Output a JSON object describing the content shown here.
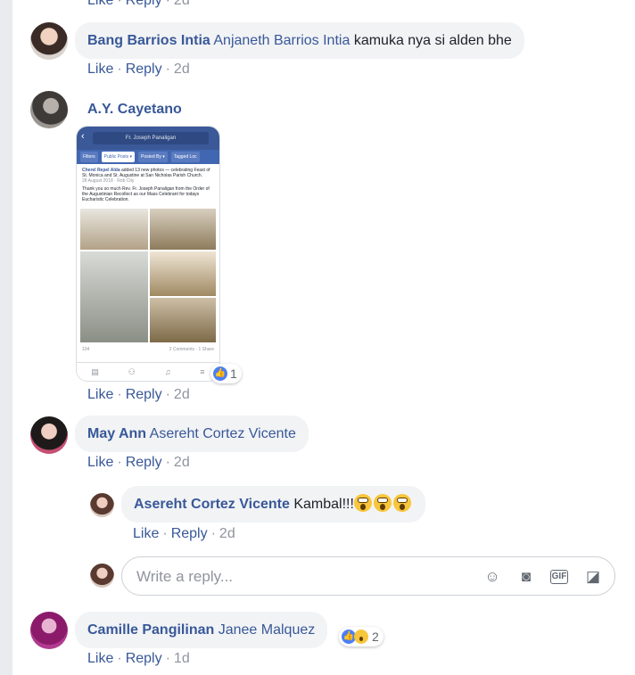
{
  "actions": {
    "like": "Like",
    "reply": "Reply"
  },
  "top_partial": {
    "time": "2d"
  },
  "comments": [
    {
      "name": "Bang Barrios Intia",
      "tag": "Anjaneth Barrios Intia",
      "text": "kamuka nya si alden bhe",
      "time": "2d"
    },
    {
      "name": "A.Y. Cayetano",
      "time": "2d",
      "reaction_count": "1"
    },
    {
      "name": "May Ann",
      "tag": "Asereht Cortez Vicente",
      "time": "2d"
    },
    {
      "name": "Asereht Cortez Vicente",
      "text": "Kambal!!!",
      "time": "2d"
    },
    {
      "name": "Camille Pangilinan",
      "tag": "Janee Malquez",
      "time": "1d",
      "reaction_count": "2"
    }
  ],
  "attachment": {
    "search_text": "Fr. Joseph Panaligan",
    "filters": [
      "Filters",
      "Public Posts ▾",
      "Posted By ▾",
      "Tagged Loc"
    ],
    "author": "Cherel Repel Alda",
    "headline": "added 13 new photos — celebrating Feast of St. Monica and St. Augustine at San Nicholas Parish Church.",
    "date": "28 August 2018 · Rob City",
    "body": "Thank you so much Rev. Fr. Joseph Panaligan from the Order of the Augustinian Recollect as our Mass Celebrant for todays Eucharistic Celebration.",
    "likes": "104",
    "meta": "2 Comments · 1 Share"
  },
  "reply_input": {
    "placeholder": "Write a reply..."
  },
  "colors": {
    "link": "#385898",
    "bubble": "#f2f3f5",
    "muted": "#90949c",
    "like_blue": "#4c7ff3"
  }
}
